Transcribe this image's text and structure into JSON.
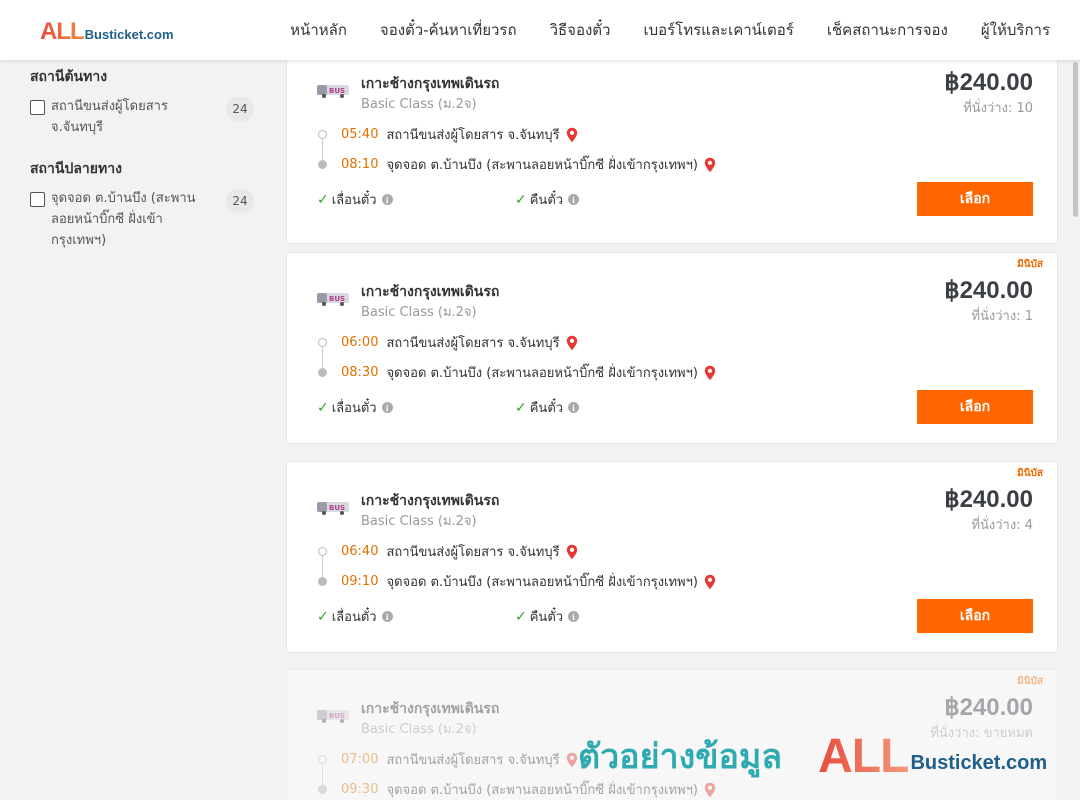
{
  "header": {
    "logo_all": "ALL",
    "logo_rest": "Busticket.com",
    "nav": [
      "หน้าหลัก",
      "จองตั๋ว-ค้นหาเที่ยวรถ",
      "วิธีจองตั๋ว",
      "เบอร์โทรและเคาน์เตอร์",
      "เช็คสถานะการจอง",
      "ผู้ให้บริการ"
    ]
  },
  "sidebar": {
    "origin_title": "สถานีต้นทาง",
    "origin_option": "สถานีขนส่งผู้โดยสาร จ.จันทบุรี",
    "origin_count": "24",
    "dest_title": "สถานีปลายทาง",
    "dest_option": "จุดจอด ต.บ้านบึง (สะพานลอยหน้าบิ๊กซี ฝั่งเข้ากรุงเทพฯ)",
    "dest_count": "24"
  },
  "trips": [
    {
      "tag": "",
      "route": "เกาะช้างกรุงเทพเดินรถ",
      "class": "Basic Class (ม.2จ)",
      "price": "฿240.00",
      "seats": "ที่นั่งว่าง: 10",
      "depart_time": "05:40",
      "depart_stop": "สถานีขนส่งผู้โดยสาร จ.จันทบุรี",
      "arrive_time": "08:10",
      "arrive_stop": "จุดจอด ต.บ้านบึง (สะพานลอยหน้าบิ๊กซี ฝั่งเข้ากรุงเทพฯ)",
      "policy_1": "เลื่อนตั๋ว",
      "policy_2": "คืนตั๋ว",
      "button": "เลือก"
    },
    {
      "tag": "มินิบัส",
      "route": "เกาะช้างกรุงเทพเดินรถ",
      "class": "Basic Class (ม.2จ)",
      "price": "฿240.00",
      "seats": "ที่นั่งว่าง: 1",
      "depart_time": "06:00",
      "depart_stop": "สถานีขนส่งผู้โดยสาร จ.จันทบุรี",
      "arrive_time": "08:30",
      "arrive_stop": "จุดจอด ต.บ้านบึง (สะพานลอยหน้าบิ๊กซี ฝั่งเข้ากรุงเทพฯ)",
      "policy_1": "เลื่อนตั๋ว",
      "policy_2": "คืนตั๋ว",
      "button": "เลือก"
    },
    {
      "tag": "มินิบัส",
      "route": "เกาะช้างกรุงเทพเดินรถ",
      "class": "Basic Class (ม.2จ)",
      "price": "฿240.00",
      "seats": "ที่นั่งว่าง: 4",
      "depart_time": "06:40",
      "depart_stop": "สถานีขนส่งผู้โดยสาร จ.จันทบุรี",
      "arrive_time": "09:10",
      "arrive_stop": "จุดจอด ต.บ้านบึง (สะพานลอยหน้าบิ๊กซี ฝั่งเข้ากรุงเทพฯ)",
      "policy_1": "เลื่อนตั๋ว",
      "policy_2": "คืนตั๋ว",
      "button": "เลือก"
    },
    {
      "tag": "มินิบัส",
      "route": "เกาะช้างกรุงเทพเดินรถ",
      "class": "Basic Class (ม.2จ)",
      "price": "฿240.00",
      "seats": "ที่นั่งว่าง: ขายหมด",
      "depart_time": "07:00",
      "depart_stop": "สถานีขนส่งผู้โดยสาร จ.จันทบุรี",
      "arrive_time": "09:30",
      "arrive_stop": "จุดจอด ต.บ้านบึง (สะพานลอยหน้าบิ๊กซี ฝั่งเข้ากรุงเทพฯ)"
    }
  ],
  "watermark": {
    "sample_text": "ตัวอย่างข้อมูล",
    "brand_all": "ALL",
    "brand_rest": "Busticket.com"
  },
  "colors": {
    "accent": "#ff6600",
    "time": "#e07000",
    "check": "#34a034",
    "pin": "#e53935",
    "watermark_text": "#2faab1",
    "brand_blue": "#1f5f8b"
  }
}
